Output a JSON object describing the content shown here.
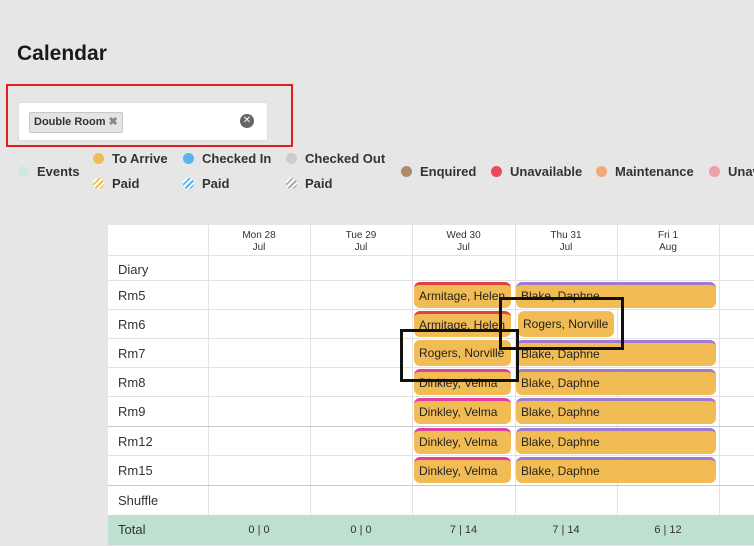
{
  "page": {
    "title": "Calendar"
  },
  "filter": {
    "chip_label": "Double Room",
    "chip_remove": "✖",
    "clear": "✕"
  },
  "legend": [
    {
      "label": "Events",
      "color": "#cfe9dc"
    },
    {
      "label": "To Arrive",
      "color": "#f2bc54"
    },
    {
      "label": "Paid",
      "color": "#f2bc54",
      "striped": true
    },
    {
      "label": "Checked In",
      "color": "#58b4f0"
    },
    {
      "label": "Paid",
      "color": "#58b4f0",
      "striped": true
    },
    {
      "label": "Checked Out",
      "color": "#cccccc"
    },
    {
      "label": "Paid",
      "color": "#aaaaaa",
      "striped": true
    },
    {
      "label": "Enquired",
      "color": "#b08a6a"
    },
    {
      "label": "Unavailable",
      "color": "#e84a5f"
    },
    {
      "label": "Maintenance",
      "color": "#f5a97a"
    },
    {
      "label": "Unav",
      "color": "#eba0aa"
    }
  ],
  "days": [
    {
      "day": "Mon 28",
      "month": "Jul"
    },
    {
      "day": "Tue 29",
      "month": "Jul"
    },
    {
      "day": "Wed 30",
      "month": "Jul"
    },
    {
      "day": "Thu 31",
      "month": "Jul"
    },
    {
      "day": "Fri 1",
      "month": "Aug"
    }
  ],
  "rows": [
    "Diary",
    "Rm5",
    "Rm6",
    "Rm7",
    "Rm8",
    "Rm9",
    "Rm12",
    "Rm15",
    "Shuffle"
  ],
  "bookings": {
    "rm5_a": "Armitage, Helen",
    "rm5_b": "Blake, Daphne",
    "rm6_a": "Armitage, Helen",
    "rm6_b": "Rogers, Norville",
    "rm7_a": "Rogers, Norville",
    "rm7_b": "Blake, Daphne",
    "rm8_a": "Dinkley, Velma",
    "rm8_b": "Blake, Daphne",
    "rm9_a": "Dinkley, Velma",
    "rm9_b": "Blake, Daphne",
    "rm12_a": "Dinkley, Velma",
    "rm12_b": "Blake, Daphne",
    "rm15_a": "Dinkley, Velma",
    "rm15_b": "Blake, Daphne"
  },
  "totals": {
    "label": "Total",
    "values": [
      "0 | 0",
      "0 | 0",
      "7 | 14",
      "7 | 14",
      "6 | 12"
    ]
  }
}
